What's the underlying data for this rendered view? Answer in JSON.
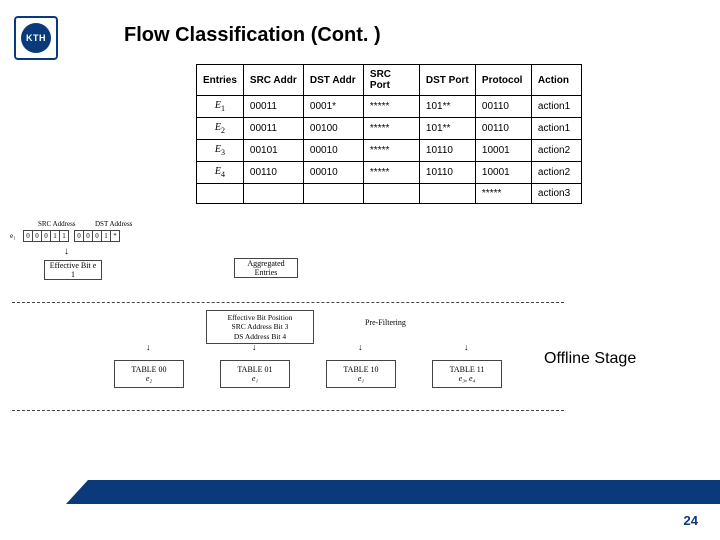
{
  "logo_text": "KTH",
  "title": "Flow Classification (Cont. )",
  "table": {
    "headers": [
      "Entries",
      "SRC Addr",
      "DST Addr",
      "SRC Port",
      "DST Port",
      "Protocol",
      "Action"
    ],
    "rows": [
      {
        "entry": "E",
        "sub": "1",
        "src": "00011",
        "dst": "0001*",
        "sp": "*****",
        "dp": "101**",
        "pr": "00110",
        "ac": "action1"
      },
      {
        "entry": "E",
        "sub": "2",
        "src": "00011",
        "dst": "00100",
        "sp": "*****",
        "dp": "101**",
        "pr": "00110",
        "ac": "action1"
      },
      {
        "entry": "E",
        "sub": "3",
        "src": "00101",
        "dst": "00010",
        "sp": "*****",
        "dp": "10110",
        "pr": "10001",
        "ac": "action2"
      },
      {
        "entry": "E",
        "sub": "4",
        "src": "00110",
        "dst": "00010",
        "sp": "*****",
        "dp": "10110",
        "pr": "10001",
        "ac": "action2"
      },
      {
        "entry": "",
        "sub": "",
        "src": "",
        "dst": "",
        "sp": "",
        "dp": "",
        "pr": "*****",
        "ac": "action3"
      }
    ]
  },
  "diagram": {
    "col_src": "SRC Address",
    "col_dst": "DST Address",
    "row_lbl": "e₁",
    "bits": [
      "0",
      "0",
      "0",
      "1",
      "1",
      "0",
      "0",
      "0",
      "1",
      "*"
    ],
    "eff_e1": "Effective Bit\ne 1",
    "agg": "Aggregated\nEntries",
    "ebp_lines": [
      "Effective Bit Position",
      "SRC Address Bit 3",
      "DS Address Bit 4"
    ],
    "prefilter": "Pre-Filtering",
    "tables": [
      {
        "hdr": "TABLE 00",
        "sub": "e₂"
      },
      {
        "hdr": "TABLE 01",
        "sub": "e₁"
      },
      {
        "hdr": "TABLE 10",
        "sub": "e₁"
      },
      {
        "hdr": "TABLE 11",
        "sub": "e₃, e₄"
      }
    ]
  },
  "offline_label": "Offline Stage",
  "page_number": "24"
}
